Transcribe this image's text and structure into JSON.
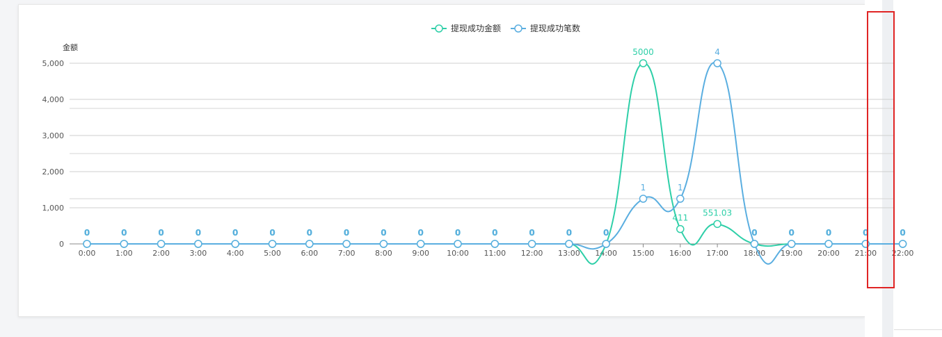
{
  "chart_data": {
    "type": "line",
    "title": "",
    "ylabel": "金额",
    "xlabel": "",
    "ylim": [
      0,
      5000
    ],
    "yticks": [
      0,
      1000,
      2000,
      3000,
      4000,
      5000
    ],
    "ytick_labels": [
      "0",
      "1,000",
      "2,000",
      "3,000",
      "4,000",
      "5,000"
    ],
    "grid": true,
    "legend_placement": "top-center",
    "categories": [
      "0:00",
      "1:00",
      "2:00",
      "3:00",
      "4:00",
      "5:00",
      "6:00",
      "7:00",
      "8:00",
      "9:00",
      "10:00",
      "11:00",
      "12:00",
      "13:00",
      "14:00",
      "15:00",
      "16:00",
      "17:00",
      "18:00",
      "19:00",
      "20:00",
      "21:00",
      "22:00"
    ],
    "series": [
      {
        "name": "提现成功金额",
        "color": "#2ecfa8",
        "values": [
          0,
          0,
          0,
          0,
          0,
          0,
          0,
          0,
          0,
          0,
          0,
          0,
          0,
          0,
          0,
          5000,
          411,
          551.03,
          0,
          0,
          0,
          0,
          0
        ],
        "labels": [
          "0",
          "0",
          "0",
          "0",
          "0",
          "0",
          "0",
          "0",
          "0",
          "0",
          "0",
          "0",
          "0",
          "0",
          "0",
          "5000",
          "411",
          "551.03",
          "0",
          "0",
          "0",
          "0",
          "0"
        ]
      },
      {
        "name": "提现成功笔数",
        "color": "#5aaee0",
        "values": [
          0,
          0,
          0,
          0,
          0,
          0,
          0,
          0,
          0,
          0,
          0,
          0,
          0,
          0,
          0,
          1250,
          1250,
          5000,
          0,
          0,
          0,
          0,
          0
        ],
        "labels": [
          "0",
          "0",
          "0",
          "0",
          "0",
          "0",
          "0",
          "0",
          "0",
          "0",
          "0",
          "0",
          "0",
          "0",
          "0",
          "1",
          "1",
          "4",
          "0",
          "0",
          "0",
          "0",
          "0"
        ]
      }
    ]
  }
}
